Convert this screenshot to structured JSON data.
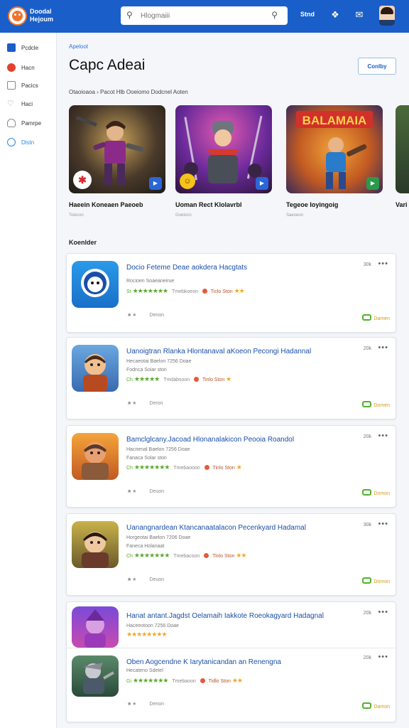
{
  "header": {
    "brand_line1": "Doodal",
    "brand_line2": "Hejoum",
    "search_placeholder": "Hlogmaiii",
    "top_link": "Stnd",
    "accent": "#1a5fc9"
  },
  "sidebar": {
    "items": [
      {
        "label": "Pcdcle",
        "icon": "grid-icon",
        "color": "#1a5fc9"
      },
      {
        "label": "Hacn",
        "icon": "home-icon",
        "color": "#e0442f"
      },
      {
        "label": "Pacics",
        "icon": "list-icon",
        "color": "#888888"
      },
      {
        "label": "Haci",
        "icon": "heart-icon",
        "color": "#888888"
      },
      {
        "label": "Pamrpe",
        "icon": "cloud-icon",
        "color": "#888888"
      },
      {
        "label": "Dlstn",
        "icon": "settings-icon",
        "color": "#2d8be0",
        "active": true
      }
    ]
  },
  "main": {
    "breadcrumb": "Apeloot",
    "title": "Capc Adeai",
    "title_button": "Conlby",
    "subtitle": "Otaoioaoa  ›  Pacot  Hlb  Ooeiomo  Dodcnel  Aoten",
    "featured": [
      {
        "name": "Haeein  Koneaen  Paeoeb",
        "meta": "Toiecon"
      },
      {
        "name": "Uoman  Rect  Klolavrbl",
        "meta": "Goetocn"
      },
      {
        "name": "Tegeoe  Ioyingoig",
        "meta": "Saeoeon"
      },
      {
        "name": "Vari",
        "meta": ""
      }
    ],
    "featured_banner_text": "BALAMAIA",
    "list_heading": "Koenlder",
    "apps": [
      {
        "title": "Docio Feteme  Deae aokdera  Hacgtats",
        "line1": "Rocioen  Soaeaneirue",
        "line2": "",
        "rating_prefix": "St",
        "stars": "★★★★★★★",
        "rating_text": "Tmebkoeon",
        "tag": "Ticlo Ston",
        "count": "30k",
        "bottom": "Denon",
        "action": "Damen"
      },
      {
        "title": "Uanoigtran  Rlanka  Hlontanaval  aKoeon  Pecongi  Hadannal",
        "line1": "Hecaeotai  Baelon  7256  Doae",
        "line2": "Fodnca  Soiar  ston",
        "rating_prefix": "Ch",
        "stars": "★★★★★",
        "rating_text": "Tmdabsoon",
        "tag": "Tinlo Ston",
        "count": "20k",
        "bottom": "Deron",
        "action": "Domen"
      },
      {
        "title": "Bamclglcany.Jacoad  Hlonanalakicon  Peooia  Roandol",
        "line1": "Hacnenal  Baelon  7256  Doae",
        "line2": "Fanaca  Solar  ston",
        "rating_prefix": "Ch",
        "stars": "★★★★★★★",
        "rating_text": "Tmebaooon",
        "tag": "Tinlo Ston",
        "count": "20k",
        "bottom": "Deuon",
        "action": "Dnmon"
      },
      {
        "title": "Uanangnardean  Ktancanaatalacon  Pecenkyard  Hadamal",
        "line1": "Horgeotai  Baelon  7206  Doae",
        "line2": "Faneca  Holanaat",
        "rating_prefix": "Ch",
        "stars": "★★★★★★★",
        "rating_text": "Tmebacoon",
        "tag": "Tinlo Ston",
        "count": "30k",
        "bottom": "Deuon",
        "action": "Domon"
      },
      {
        "title": "Hanat  antant.Jagdst  Oelamaih  Iakkote  Roeokagyard  Hadagnal",
        "line1": "Haceeotoon  7256  Doae",
        "line2": "",
        "rating_prefix": "",
        "stars": "★★★★★★★★",
        "rating_text": "",
        "tag": "",
        "count": "20k",
        "bottom": "",
        "action": ""
      },
      {
        "title": "Oben  Aogcendne  K  Iarytanicandan  an  Renengna",
        "line1": "Hecateno  Sdetel",
        "line2": "",
        "rating_prefix": "Gi",
        "stars": "★★★★★★★",
        "rating_text": "Tmebaoon",
        "tag": "Tidlo Ston",
        "count": "20k",
        "bottom": "Denon",
        "action": "Damon"
      }
    ]
  }
}
